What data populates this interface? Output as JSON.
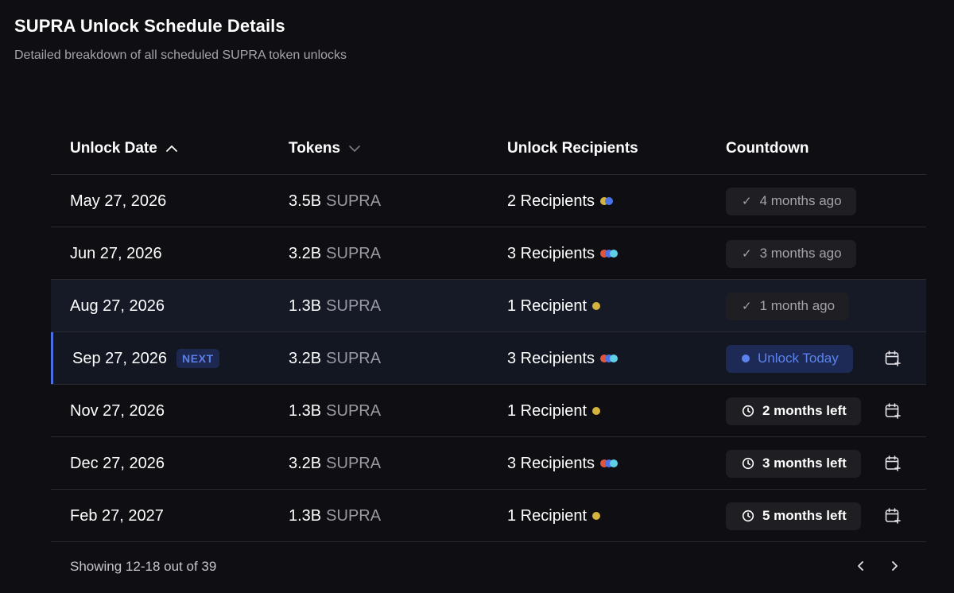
{
  "header": {
    "title": "SUPRA Unlock Schedule Details",
    "subtitle": "Detailed breakdown of all scheduled SUPRA token unlocks"
  },
  "table": {
    "columns": [
      {
        "label": "Unlock Date",
        "sort": "ascending"
      },
      {
        "label": "Tokens",
        "sort": "descending"
      },
      {
        "label": "Unlock Recipients"
      },
      {
        "label": "Countdown"
      }
    ],
    "rows": [
      {
        "date": "May 27, 2026",
        "amount": "3.5B",
        "unit": "SUPRA",
        "recipients": "2 Recipients",
        "dot_colors": [
          "#d4b43c",
          "#4a73e8"
        ],
        "countdown": "4 months ago",
        "status": "past",
        "badge": "",
        "calendar": false
      },
      {
        "date": "Jun 27, 2026",
        "amount": "3.2B",
        "unit": "SUPRA",
        "recipients": "3 Recipients",
        "dot_colors": [
          "#e0553d",
          "#4a73e8",
          "#5ed0e6"
        ],
        "countdown": "3 months ago",
        "status": "past",
        "badge": "",
        "calendar": false
      },
      {
        "date": "Aug 27, 2026",
        "amount": "1.3B",
        "unit": "SUPRA",
        "recipients": "1 Recipient",
        "dot_colors": [
          "#d4b43c"
        ],
        "countdown": "1 month ago",
        "status": "past",
        "badge": "",
        "calendar": false,
        "highlight": true
      },
      {
        "date": "Sep 27, 2026",
        "amount": "3.2B",
        "unit": "SUPRA",
        "recipients": "3 Recipients",
        "dot_colors": [
          "#e0553d",
          "#4a73e8",
          "#5ed0e6"
        ],
        "countdown": "Unlock Today",
        "status": "today",
        "badge": "NEXT",
        "calendar": true
      },
      {
        "date": "Nov 27, 2026",
        "amount": "1.3B",
        "unit": "SUPRA",
        "recipients": "1 Recipient",
        "dot_colors": [
          "#d4b43c"
        ],
        "countdown": "2 months left",
        "status": "future",
        "badge": "",
        "calendar": true
      },
      {
        "date": "Dec 27, 2026",
        "amount": "3.2B",
        "unit": "SUPRA",
        "recipients": "3 Recipients",
        "dot_colors": [
          "#e0553d",
          "#4a73e8",
          "#5ed0e6"
        ],
        "countdown": "3 months left",
        "status": "future",
        "badge": "",
        "calendar": true
      },
      {
        "date": "Feb 27, 2027",
        "amount": "1.3B",
        "unit": "SUPRA",
        "recipients": "1 Recipient",
        "dot_colors": [
          "#d4b43c"
        ],
        "countdown": "5 months left",
        "status": "future",
        "badge": "",
        "calendar": true
      }
    ]
  },
  "footer": {
    "showing": "Showing 12-18 out of 39",
    "prev_icon": "chevron-left-icon",
    "next_icon": "chevron-right-icon"
  },
  "colors": {
    "background": "#0f0f13",
    "accent": "#4a6fe0",
    "next_badge_bg": "#1c2850"
  }
}
